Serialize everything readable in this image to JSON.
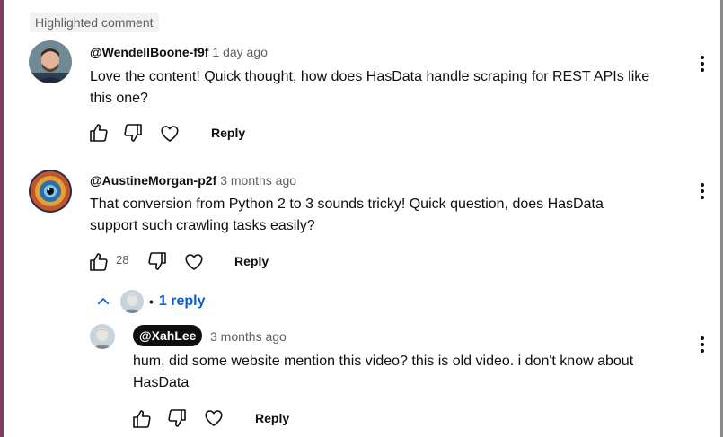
{
  "highlight_label": "Highlighted comment",
  "comments": [
    {
      "author": "@WendellBoone-f9f",
      "time": "1 day ago",
      "text_line1": "Love the content! Quick thought, how does HasData handle scraping for REST APIs like",
      "text_line2": "this one?",
      "likes": "",
      "reply_label": "Reply"
    },
    {
      "author": "@AustineMorgan-p2f",
      "time": "3 months ago",
      "text_line1": "That conversion from Python 2 to 3 sounds tricky! Quick question, does HasData",
      "text_line2": "support such crawling tasks easily?",
      "likes": "28",
      "reply_label": "Reply",
      "replies_toggle": "1 reply",
      "reply": {
        "author": "@XahLee",
        "time": "3 months ago",
        "text_line1": "hum, did some website mention this video? this is old video. i don't know about",
        "text_line2": "HasData",
        "reply_label": "Reply"
      }
    }
  ],
  "icons": {
    "like": "thumbs-up-icon",
    "dislike": "thumbs-down-icon",
    "heart": "heart-icon",
    "more": "more-vert-icon",
    "chevron": "chevron-up-icon"
  },
  "colors": {
    "link": "#065fd4",
    "meta": "#606060",
    "chip_bg": "#0f0f0f"
  }
}
